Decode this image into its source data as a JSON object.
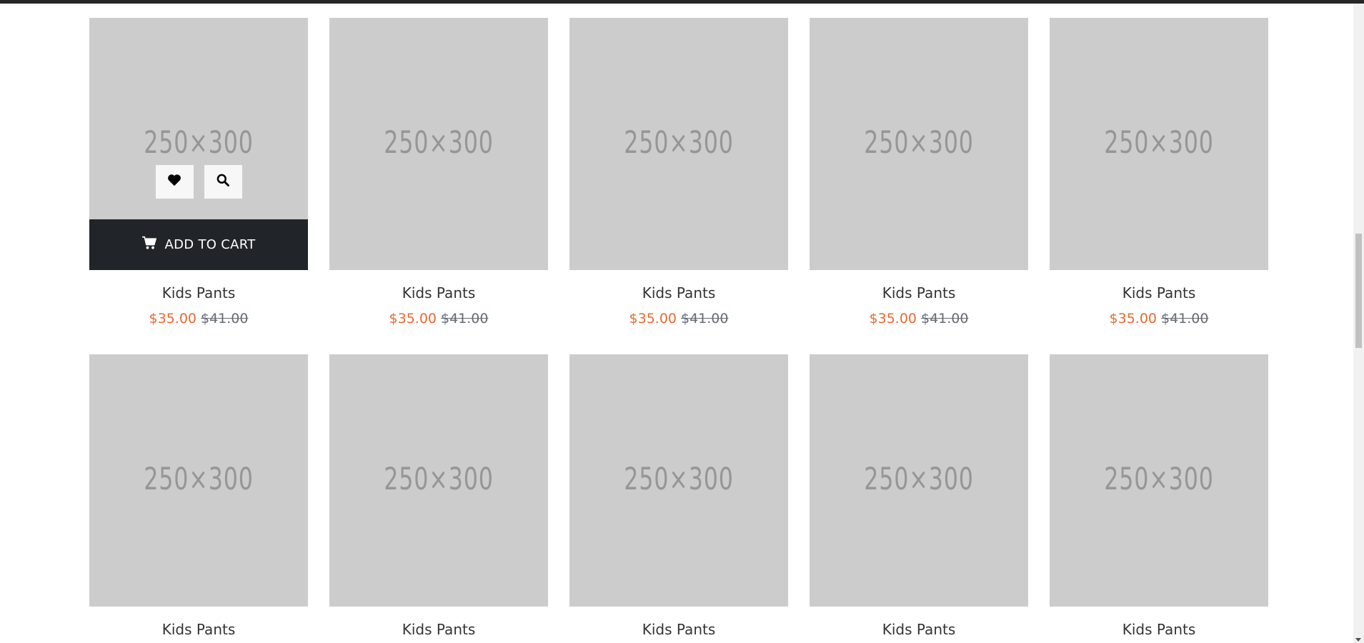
{
  "placeholder_label": "250×300",
  "add_to_cart_label": "ADD TO CART",
  "colors": {
    "sale_price": "#e8692d",
    "old_price": "#666b73",
    "cart_bar": "#212529",
    "image_placeholder": "#cccccc"
  },
  "icons": {
    "wishlist": "heart-icon",
    "quick_view": "search-icon",
    "cart": "cart-icon"
  },
  "products": [
    {
      "name": "Kids Pants",
      "price": "$35.00",
      "old_price": "$41.00",
      "hovered": true
    },
    {
      "name": "Kids Pants",
      "price": "$35.00",
      "old_price": "$41.00",
      "hovered": false
    },
    {
      "name": "Kids Pants",
      "price": "$35.00",
      "old_price": "$41.00",
      "hovered": false
    },
    {
      "name": "Kids Pants",
      "price": "$35.00",
      "old_price": "$41.00",
      "hovered": false
    },
    {
      "name": "Kids Pants",
      "price": "$35.00",
      "old_price": "$41.00",
      "hovered": false
    },
    {
      "name": "Kids Pants",
      "price": "",
      "old_price": "",
      "hovered": false
    },
    {
      "name": "Kids Pants",
      "price": "",
      "old_price": "",
      "hovered": false
    },
    {
      "name": "Kids Pants",
      "price": "",
      "old_price": "",
      "hovered": false
    },
    {
      "name": "Kids Pants",
      "price": "",
      "old_price": "",
      "hovered": false
    },
    {
      "name": "Kids Pants",
      "price": "",
      "old_price": "",
      "hovered": false
    }
  ]
}
